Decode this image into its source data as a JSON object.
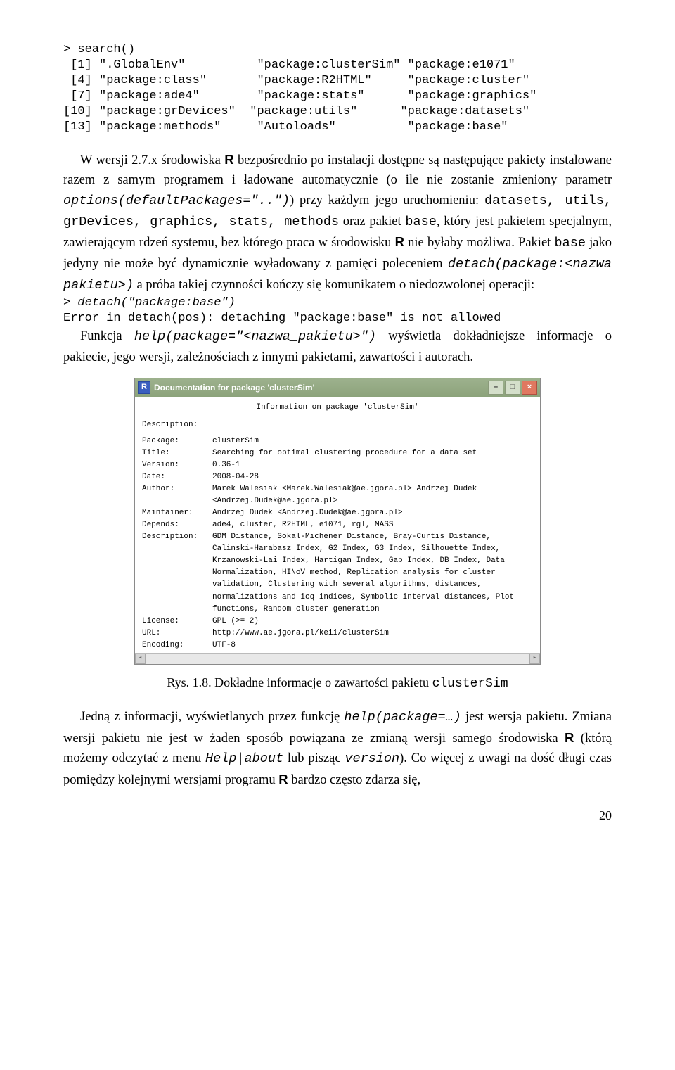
{
  "code1": "> search()\n [1] \".GlobalEnv\"          \"package:clusterSim\" \"package:e1071\"\n [4] \"package:class\"       \"package:R2HTML\"     \"package:cluster\"\n [7] \"package:ade4\"        \"package:stats\"      \"package:graphics\"\n[10] \"package:grDevices\"  \"package:utils\"      \"package:datasets\"\n[13] \"package:methods\"     \"Autoloads\"          \"package:base\"",
  "p1a": "W wersji 2.7.x środowiska ",
  "p1b": " bezpośrednio po instalacji dostępne są następujące pakiety instalowane razem z samym programem i ładowane automatycznie (o ile nie zostanie zmieniony parametr ",
  "p1_opt": "options(defaultPackages=\"..\")",
  "p1c": ") przy każdym jego uruchomieniu: ",
  "p1_pkgs": "datasets, utils, grDevices, graphics, stats, methods",
  "p1d": " oraz pakiet ",
  "p1_base": "base",
  "p1e": ", który jest pakietem specjalnym, zawierającym rdzeń systemu, bez którego praca w środowisku ",
  "p1f": " nie byłaby możliwa. Pakiet ",
  "p1g": " jako jedyny nie może być dynamicznie wyładowany z pamięci poleceniem ",
  "p1_detach": "detach(package:<nazwa pakietu>)",
  "p1h": " a próba takiej czynności kończy się komunikatem o niedozwolonej operacji:",
  "code2a": "> detach(\"package:base\")",
  "code2b": "Error in detach(pos): detaching \"package:base\" is not allowed",
  "p2a": "Funkcja ",
  "p2_help": "help(package=\"<nazwa_pakietu>\")",
  "p2b": " wyświetla dokładniejsze informacje o pakiecie, jego wersji, zależnościach z innymi pakietami, zawartości i autorach.",
  "win_title": "Documentation for package 'clusterSim'",
  "info_line": "Information on package 'clusterSim'",
  "desc_header": "Description:",
  "rows": [
    {
      "k": "Package:",
      "v": "clusterSim"
    },
    {
      "k": "Title:",
      "v": "Searching for optimal clustering procedure for a data set"
    },
    {
      "k": "Version:",
      "v": "0.36-1"
    },
    {
      "k": "Date:",
      "v": "2008-04-28"
    },
    {
      "k": "Author:",
      "v": "Marek Walesiak <Marek.Walesiak@ae.jgora.pl> Andrzej Dudek <Andrzej.Dudek@ae.jgora.pl>"
    },
    {
      "k": "Maintainer:",
      "v": "Andrzej Dudek <Andrzej.Dudek@ae.jgora.pl>"
    },
    {
      "k": "Depends:",
      "v": "ade4, cluster, R2HTML, e1071, rgl, MASS"
    },
    {
      "k": "Description:",
      "v": "GDM Distance, Sokal-Michener Distance, Bray-Curtis Distance, Calinski-Harabasz Index, G2 Index, G3 Index, Silhouette Index, Krzanowski-Lai Index, Hartigan Index, Gap Index, DB Index, Data Normalization, HINoV method, Replication analysis for cluster validation, Clustering with several algorithms, distances, normalizations and icq indices, Symbolic interval distances, Plot functions, Random cluster generation"
    },
    {
      "k": "License:",
      "v": "GPL (>= 2)"
    },
    {
      "k": "URL:",
      "v": "http://www.ae.jgora.pl/keii/clusterSim"
    },
    {
      "k": "Encoding:",
      "v": "UTF-8"
    }
  ],
  "caption_a": "Rys. 1.8. Dokładne informacje o zawartości pakietu ",
  "caption_b": "clusterSim",
  "p3a": "Jedną z informacji, wyświetlanych przez funkcję ",
  "p3_help": "help(package=…)",
  "p3b": " jest wersja pakietu. Zmiana wersji pakietu nie jest w żaden sposób powiązana ze zmianą wersji samego środowiska ",
  "p3c": " (którą możemy odczytać z menu ",
  "p3_menu": "Help|about",
  "p3d": " lub pisząc ",
  "p3_ver": "version",
  "p3e": "). Co więcej z uwagi na dość długi czas pomiędzy kolejnymi wersjami programu ",
  "p3f": " bardzo często zdarza się,",
  "R": "R",
  "pagenum": "20"
}
